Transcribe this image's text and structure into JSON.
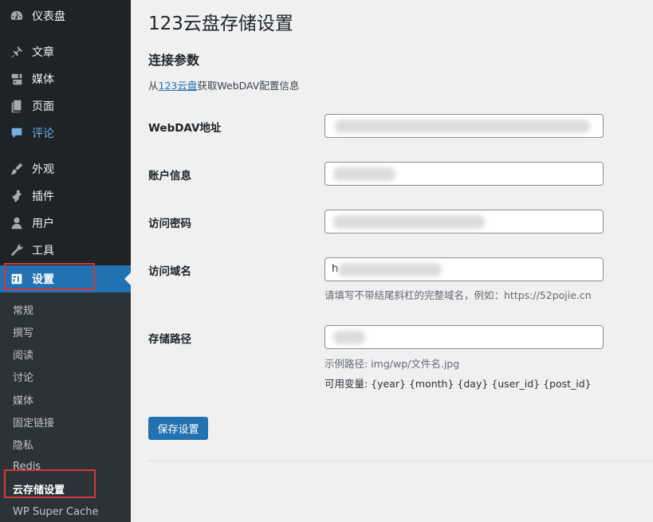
{
  "sidebar": {
    "menu": [
      {
        "label": "仪表盘",
        "icon": "dashboard-icon"
      },
      {
        "label": "文章",
        "icon": "pin-icon"
      },
      {
        "label": "媒体",
        "icon": "media-icon"
      },
      {
        "label": "页面",
        "icon": "pages-icon"
      },
      {
        "label": "评论",
        "icon": "comment-icon"
      },
      {
        "label": "外观",
        "icon": "brush-icon"
      },
      {
        "label": "插件",
        "icon": "plugin-icon"
      },
      {
        "label": "用户",
        "icon": "user-icon"
      },
      {
        "label": "工具",
        "icon": "wrench-icon"
      },
      {
        "label": "设置",
        "icon": "settings-icon",
        "active": true
      }
    ],
    "submenu": [
      {
        "label": "常规"
      },
      {
        "label": "撰写"
      },
      {
        "label": "阅读"
      },
      {
        "label": "讨论"
      },
      {
        "label": "媒体"
      },
      {
        "label": "固定链接"
      },
      {
        "label": "隐私"
      },
      {
        "label": "Redis"
      },
      {
        "label": "云存储设置",
        "current": true
      },
      {
        "label": "WP Super Cache"
      }
    ]
  },
  "main": {
    "title": "123云盘存储设置",
    "section_title": "连接参数",
    "desc_prefix": "从",
    "desc_link": "123云盘",
    "desc_suffix": "获取WebDAV配置信息",
    "fields": [
      {
        "label": "WebDAV地址",
        "value": ""
      },
      {
        "label": "账户信息",
        "value": ""
      },
      {
        "label": "访问密码",
        "value": ""
      },
      {
        "label": "访问域名",
        "value": "h",
        "hint": "请填写不带结尾斜杠的完整域名，例如：https://52pojie.cn"
      },
      {
        "label": "存储路径",
        "value": "",
        "hint": "示例路径: img/wp/文件名.jpg",
        "hint2": "可用变量: {year} {month} {day} {user_id} {post_id}"
      }
    ],
    "save_label": "保存设置"
  },
  "colors": {
    "sidebar_bg": "#1d2327",
    "submenu_bg": "#2c3338",
    "accent": "#2271b1",
    "highlight_box": "#d63638"
  }
}
